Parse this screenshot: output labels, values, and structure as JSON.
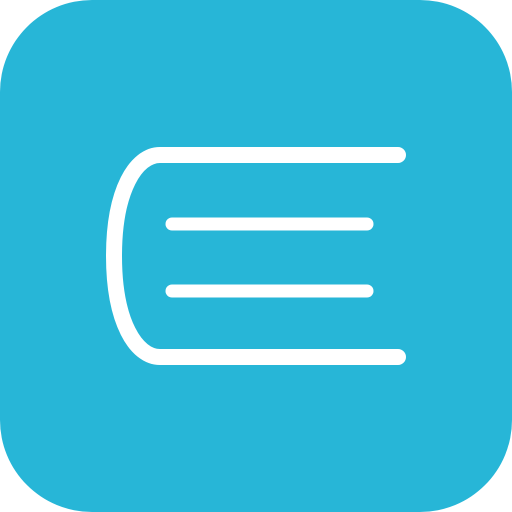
{
  "icon": {
    "name": "book-icon",
    "background_color": "#27B6D7",
    "stroke_color": "#FFFFFF"
  }
}
